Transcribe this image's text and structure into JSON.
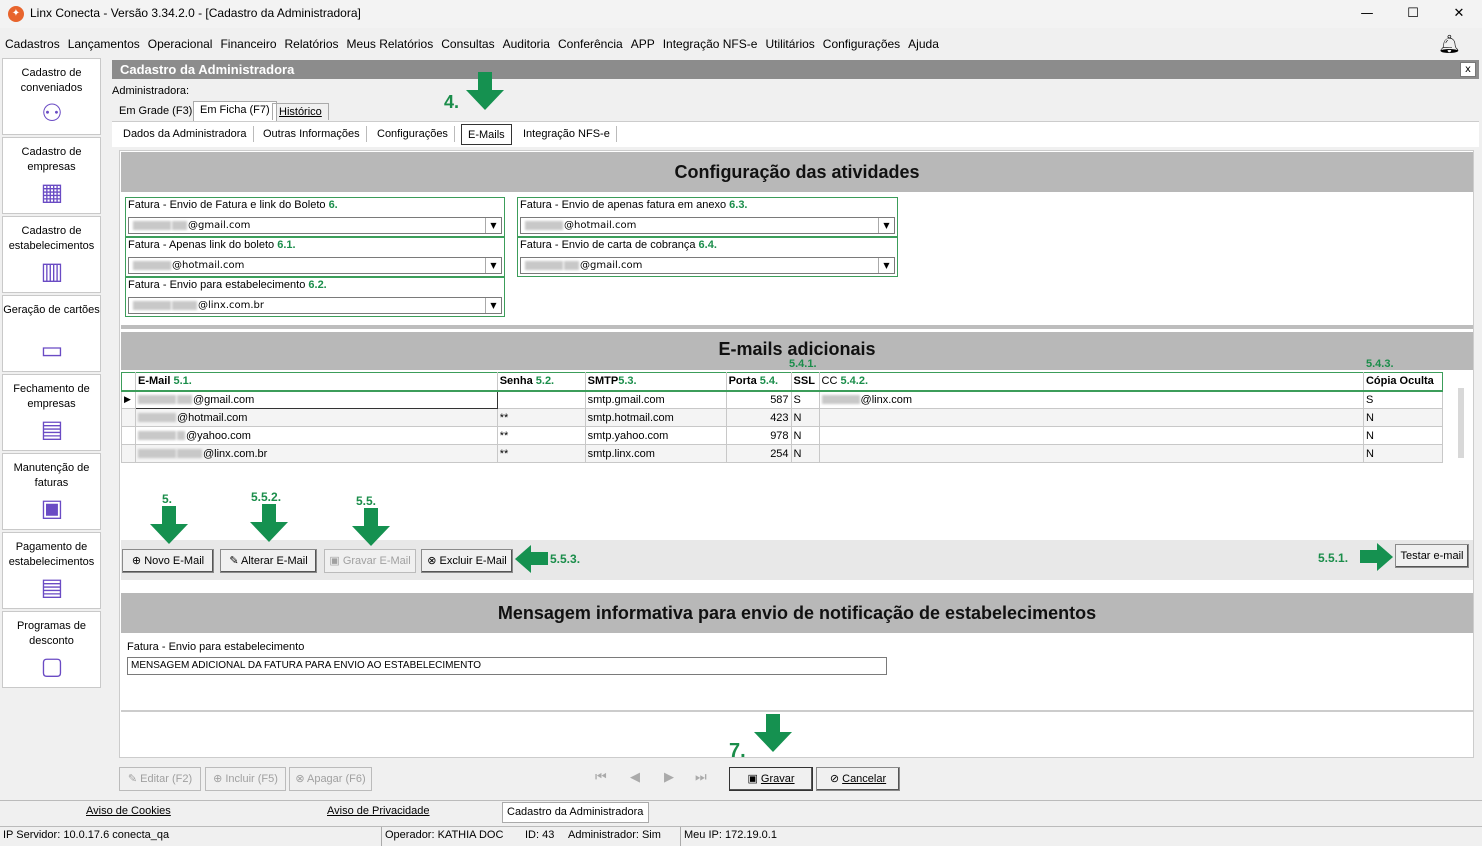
{
  "window": {
    "title": "Linx Conecta - Versão 3.34.2.0 - [Cadastro da Administradora]",
    "minimize": "—",
    "maximize": "☐",
    "close": "✕"
  },
  "menu": [
    "Cadastros",
    "Lançamentos",
    "Operacional",
    "Financeiro",
    "Relatórios",
    "Meus Relatórios",
    "Consultas",
    "Auditoria",
    "Conferência",
    "APP",
    "Integração NFS-e",
    "Utilitários",
    "Configurações",
    "Ajuda"
  ],
  "sidebar": [
    {
      "label": "Cadastro de conveniados",
      "icon": "person-icon"
    },
    {
      "label": "Cadastro de empresas",
      "icon": "building-icon"
    },
    {
      "label": "Cadastro de estabelecimentos",
      "icon": "store-icon"
    },
    {
      "label": "Geração de cartões",
      "icon": "card-icon"
    },
    {
      "label": "Fechamento de empresas",
      "icon": "invoice-icon"
    },
    {
      "label": "Manutenção de faturas",
      "icon": "tray-icon"
    },
    {
      "label": "Pagamento de estabelecimentos",
      "icon": "payment-icon"
    },
    {
      "label": "Programas de desconto",
      "icon": "discount-icon"
    }
  ],
  "form": {
    "title": "Cadastro da Administradora",
    "close": "x",
    "admin_label": "Administradora:"
  },
  "view_tabs": [
    "Em Grade (F3)",
    "Em Ficha (F7)",
    "Histórico"
  ],
  "sub_tabs": [
    "Dados da Administradora",
    "Outras Informações",
    "Configurações",
    "E-Mails",
    "Integração NFS-e"
  ],
  "activities": {
    "title": "Configuração das atividades",
    "groups": [
      {
        "label": "Fatura - Envio de Fatura e link do Boleto",
        "num": "6.",
        "value": "@gmail.com"
      },
      {
        "label": "Fatura - Envio de apenas fatura em anexo",
        "num": "6.3.",
        "value": "@hotmail.com"
      },
      {
        "label": "Fatura - Apenas link do boleto",
        "num": "6.1.",
        "value": "@hotmail.com"
      },
      {
        "label": "Fatura - Envio de carta de cobrança",
        "num": "6.4.",
        "value": "@gmail.com"
      },
      {
        "label": "Fatura - Envio para estabelecimento",
        "num": "6.2.",
        "value": "@linx.com.br"
      }
    ]
  },
  "emails": {
    "title": "E-mails adicionais",
    "columns": [
      {
        "label": "E-Mail",
        "num": "5.1."
      },
      {
        "label": "Senha",
        "num": "5.2."
      },
      {
        "label": "SMTP",
        "num": "5.3."
      },
      {
        "label": "Porta",
        "num": "5.4."
      },
      {
        "label": "SSL",
        "num": "5.4.1."
      },
      {
        "label": "CC",
        "num": "5.4.2."
      },
      {
        "label": "Cópia Oculta",
        "num": "5.4.3."
      }
    ],
    "rows": [
      {
        "email": "@gmail.com",
        "senha": "",
        "smtp": "smtp.gmail.com",
        "porta": "587",
        "ssl": "S",
        "cc": "@linx.com",
        "oculta": "S"
      },
      {
        "email": "@hotmail.com",
        "senha": "**",
        "smtp": "smtp.hotmail.com",
        "porta": "423",
        "ssl": "N",
        "cc": "",
        "oculta": "N"
      },
      {
        "email": "@yahoo.com",
        "senha": "**",
        "smtp": "smtp.yahoo.com",
        "porta": "978",
        "ssl": "N",
        "cc": "",
        "oculta": "N"
      },
      {
        "email": "@linx.com.br",
        "senha": "**",
        "smtp": "smtp.linx.com",
        "porta": "254",
        "ssl": "N",
        "cc": "",
        "oculta": "N"
      }
    ],
    "buttons": {
      "novo": "Novo E-Mail",
      "alterar": "Alterar E-Mail",
      "gravar": "Gravar E-Mail",
      "excluir": "Excluir E-Mail",
      "testar": "Testar e-mail"
    }
  },
  "message": {
    "title": "Mensagem informativa para envio de notificação de estabelecimentos",
    "label": "Fatura - Envio para estabelecimento",
    "value": "MENSAGEM ADICIONAL DA FATURA PARA ENVIO AO ESTABELECIMENTO"
  },
  "annotations": {
    "a4": "4.",
    "a5": "5.",
    "a552": "5.5.2.",
    "a55": "5.5.",
    "a553": "5.5.3.",
    "a551": "5.5.1.",
    "a7": "7."
  },
  "bottom": {
    "editar": "Editar (F2)",
    "incluir": "Incluir (F5)",
    "apagar": "Apagar (F6)",
    "gravar": "Gravar",
    "cancelar": "Cancelar"
  },
  "status": {
    "cookies": "Aviso de Cookies",
    "privacidade": "Aviso de Privacidade",
    "tab": "Cadastro da Administradora",
    "servidor": "IP Servidor: 10.0.17.6 conecta_qa",
    "operador": "Operador: KATHIA DOC",
    "id": "ID: 43",
    "admin": "Administrador: Sim",
    "ip": "Meu IP: 172.19.0.1"
  },
  "colors": {
    "accent_green": "#159150",
    "header_gray": "#8c8c8c",
    "section_gray": "#b8b8b8",
    "icon_purple": "#6a4bc4"
  }
}
